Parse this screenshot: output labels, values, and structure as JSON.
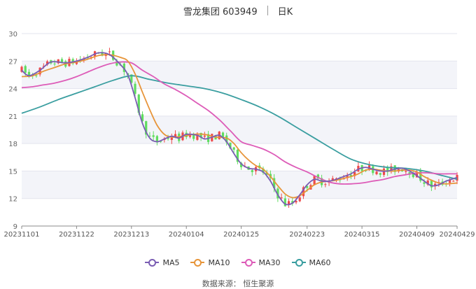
{
  "chart_data": {
    "type": "candlestick-line",
    "title": "雪龙集团 603949",
    "period": "日K",
    "source": "数据来源： 恒生聚源",
    "ylim": [
      9,
      30
    ],
    "yticks": [
      9,
      12,
      15,
      18,
      21,
      24,
      27,
      30
    ],
    "x_ticks": [
      "20231101",
      "20231122",
      "20231213",
      "20240104",
      "20240125",
      "20240223",
      "20240315",
      "20240409",
      "20240429"
    ],
    "colors": {
      "up": "#ee4a4a",
      "down": "#5fdc5f",
      "MA5": "#7a5db3",
      "MA10": "#e7953a",
      "MA30": "#dd5cb8",
      "MA60": "#3a9ea0"
    },
    "x_range": [
      0,
      119
    ],
    "tick_positions": [
      0,
      15,
      30,
      45,
      60,
      78,
      93,
      108,
      119
    ],
    "series": [
      {
        "name": "MA5",
        "values": [
          [
            0,
            26.0
          ],
          [
            2,
            25.4
          ],
          [
            5,
            26.0
          ],
          [
            8,
            26.9
          ],
          [
            12,
            26.8
          ],
          [
            15,
            27.0
          ],
          [
            18,
            27.4
          ],
          [
            21,
            27.9
          ],
          [
            24,
            27.7
          ],
          [
            27,
            26.6
          ],
          [
            29,
            25.5
          ],
          [
            31,
            23.0
          ],
          [
            33,
            20.2
          ],
          [
            35,
            18.6
          ],
          [
            37,
            18.2
          ],
          [
            39,
            18.5
          ],
          [
            41,
            18.8
          ],
          [
            43,
            18.6
          ],
          [
            45,
            19.0
          ],
          [
            48,
            18.9
          ],
          [
            50,
            18.5
          ],
          [
            52,
            18.7
          ],
          [
            54,
            18.9
          ],
          [
            56,
            18.2
          ],
          [
            58,
            16.9
          ],
          [
            60,
            15.8
          ],
          [
            62,
            15.3
          ],
          [
            64,
            15.2
          ],
          [
            66,
            14.9
          ],
          [
            68,
            13.9
          ],
          [
            70,
            12.4
          ],
          [
            72,
            11.4
          ],
          [
            74,
            11.5
          ],
          [
            76,
            12.4
          ],
          [
            78,
            13.5
          ],
          [
            80,
            14.1
          ],
          [
            82,
            13.9
          ],
          [
            84,
            13.9
          ],
          [
            86,
            14.1
          ],
          [
            88,
            14.4
          ],
          [
            90,
            14.7
          ],
          [
            92,
            15.2
          ],
          [
            94,
            15.4
          ],
          [
            96,
            15.2
          ],
          [
            98,
            15.0
          ],
          [
            100,
            15.0
          ],
          [
            102,
            15.2
          ],
          [
            104,
            15.3
          ],
          [
            106,
            15.0
          ],
          [
            108,
            14.5
          ],
          [
            110,
            13.9
          ],
          [
            112,
            13.4
          ],
          [
            114,
            13.5
          ],
          [
            116,
            13.9
          ],
          [
            119,
            14.3
          ]
        ]
      },
      {
        "name": "MA10",
        "values": [
          [
            0,
            25.3
          ],
          [
            3,
            25.4
          ],
          [
            6,
            25.9
          ],
          [
            9,
            26.3
          ],
          [
            12,
            26.7
          ],
          [
            15,
            26.9
          ],
          [
            18,
            27.2
          ],
          [
            21,
            27.6
          ],
          [
            24,
            27.7
          ],
          [
            27,
            27.4
          ],
          [
            29,
            27.0
          ],
          [
            31,
            25.6
          ],
          [
            33,
            23.6
          ],
          [
            35,
            21.7
          ],
          [
            37,
            20.0
          ],
          [
            39,
            19.0
          ],
          [
            41,
            18.7
          ],
          [
            44,
            18.8
          ],
          [
            47,
            19.0
          ],
          [
            50,
            19.0
          ],
          [
            53,
            18.7
          ],
          [
            56,
            18.6
          ],
          [
            58,
            18.0
          ],
          [
            60,
            17.0
          ],
          [
            62,
            16.2
          ],
          [
            64,
            15.6
          ],
          [
            66,
            15.2
          ],
          [
            68,
            14.4
          ],
          [
            70,
            13.4
          ],
          [
            72,
            12.5
          ],
          [
            74,
            12.1
          ],
          [
            76,
            12.3
          ],
          [
            78,
            12.9
          ],
          [
            80,
            13.5
          ],
          [
            82,
            13.8
          ],
          [
            84,
            13.9
          ],
          [
            86,
            14.0
          ],
          [
            88,
            14.2
          ],
          [
            90,
            14.4
          ],
          [
            92,
            14.7
          ],
          [
            94,
            15.1
          ],
          [
            96,
            15.2
          ],
          [
            98,
            15.1
          ],
          [
            100,
            15.0
          ],
          [
            102,
            15.0
          ],
          [
            104,
            15.1
          ],
          [
            106,
            15.1
          ],
          [
            108,
            14.9
          ],
          [
            110,
            14.4
          ],
          [
            112,
            14.0
          ],
          [
            114,
            13.7
          ],
          [
            116,
            13.6
          ],
          [
            119,
            13.7
          ]
        ]
      },
      {
        "name": "MA30",
        "values": [
          [
            0,
            24.1
          ],
          [
            3,
            24.2
          ],
          [
            6,
            24.4
          ],
          [
            9,
            24.6
          ],
          [
            12,
            24.9
          ],
          [
            15,
            25.3
          ],
          [
            18,
            25.8
          ],
          [
            21,
            26.3
          ],
          [
            24,
            26.7
          ],
          [
            27,
            26.9
          ],
          [
            30,
            26.8
          ],
          [
            33,
            26.0
          ],
          [
            36,
            25.3
          ],
          [
            39,
            24.5
          ],
          [
            42,
            23.9
          ],
          [
            45,
            23.2
          ],
          [
            48,
            22.4
          ],
          [
            51,
            21.6
          ],
          [
            54,
            20.6
          ],
          [
            57,
            19.4
          ],
          [
            60,
            18.2
          ],
          [
            63,
            17.8
          ],
          [
            66,
            17.4
          ],
          [
            69,
            16.8
          ],
          [
            72,
            16.0
          ],
          [
            75,
            15.4
          ],
          [
            78,
            14.9
          ],
          [
            81,
            14.3
          ],
          [
            84,
            13.8
          ],
          [
            87,
            13.6
          ],
          [
            90,
            13.6
          ],
          [
            93,
            13.7
          ],
          [
            96,
            13.9
          ],
          [
            99,
            14.1
          ],
          [
            102,
            14.4
          ],
          [
            105,
            14.6
          ],
          [
            108,
            14.8
          ],
          [
            111,
            14.8
          ],
          [
            114,
            14.7
          ],
          [
            117,
            14.7
          ],
          [
            119,
            14.7
          ]
        ]
      },
      {
        "name": "MA60",
        "values": [
          [
            0,
            21.3
          ],
          [
            5,
            22.0
          ],
          [
            10,
            22.8
          ],
          [
            15,
            23.5
          ],
          [
            20,
            24.2
          ],
          [
            25,
            24.9
          ],
          [
            30,
            25.4
          ],
          [
            35,
            25.0
          ],
          [
            40,
            24.6
          ],
          [
            45,
            24.3
          ],
          [
            50,
            24.0
          ],
          [
            55,
            23.5
          ],
          [
            60,
            22.8
          ],
          [
            65,
            22.0
          ],
          [
            70,
            21.0
          ],
          [
            75,
            19.8
          ],
          [
            80,
            18.6
          ],
          [
            85,
            17.4
          ],
          [
            90,
            16.3
          ],
          [
            95,
            15.7
          ],
          [
            100,
            15.4
          ],
          [
            105,
            15.3
          ],
          [
            110,
            15.0
          ],
          [
            115,
            14.5
          ],
          [
            119,
            14.1
          ]
        ]
      }
    ]
  }
}
